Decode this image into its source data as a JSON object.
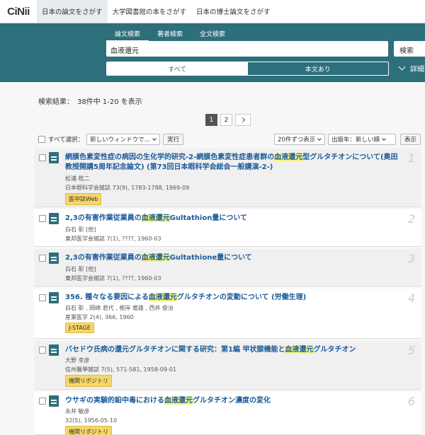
{
  "topbar": {
    "logo": "CiNii",
    "tabs": [
      "日本の論文をさがす",
      "大学図書館の本をさがす",
      "日本の博士論文をさがす"
    ]
  },
  "search": {
    "tabs": [
      "論文検索",
      "著者検索",
      "全文検索"
    ],
    "query": "血液還元",
    "button": "検索",
    "filters": [
      "すべて",
      "本文あり"
    ],
    "advanced": "詳細"
  },
  "results": {
    "count_text": "検索結果：　38件中 1-20 を表示",
    "pages": [
      "1",
      "2"
    ],
    "toolbar": {
      "select_all": "すべて選択：",
      "window_select": "新しいウィンドウで…",
      "run": "実行",
      "per_page": "20件ずつ表示",
      "sort": "出版年：新しい順",
      "show": "表示"
    },
    "items": [
      {
        "num": "1",
        "t1": "網膜色素変性症の病因の生化学的研究-2-網膜色素変性症患者群の",
        "hl": "血液還元",
        "t2": "型グルタチオンについて(奥田教授開講5周年記念論文) (第73回日本眼科学会総会一般講演-2-)",
        "author": "松浦 皓二",
        "journal": "日本眼科学会雑誌 73(9), 1783-1788, 1969-09",
        "badge": "医中誌Web"
      },
      {
        "num": "2",
        "t1": "2,3の有害作業従業員の",
        "hl": "血液還元",
        "t2": "Gultathion量について",
        "author": "白石 彰 [他]",
        "journal": "東邦医学会雑誌 7(1), ????, 1960-03",
        "badge": ""
      },
      {
        "num": "3",
        "t1": "2,3の有害作業従業員の",
        "hl": "血液還元",
        "t2": "Gultathione量について",
        "author": "白石 彰 [他]",
        "journal": "東邦医学会雑誌 7(1), ????, 1960-03",
        "badge": ""
      },
      {
        "num": "4",
        "t1": "356. 種々なる要因による",
        "hl": "血液還元",
        "t2": "グルタチオンの変動について (労働生理)",
        "author": "白石 彰 , 岡崎 君代 , 根岸 竜雄 , 西井 俊治",
        "journal": "産業医学 2(4), 366, 1960",
        "badge": "J-STAGE"
      },
      {
        "num": "5",
        "t1": "バセドウ氏病の還元グルタチオンに関する研究：第1編 甲状腺機能と",
        "hl": "血液還元",
        "t2": "グルタチオン",
        "author": "大野 幸彦",
        "journal": "信州醫學雑誌 7(5), 571-581, 1958-09-01",
        "badge": "機関リポジトリ"
      },
      {
        "num": "6",
        "t1": "ウサギの実験的鉛中毒における",
        "hl": "血液還元",
        "t2": "グルタチオン濃度の変化",
        "author": "永井 敏彦",
        "journal": "32(5), 1956-05-10",
        "badge": "機関リポジトリ"
      }
    ]
  }
}
